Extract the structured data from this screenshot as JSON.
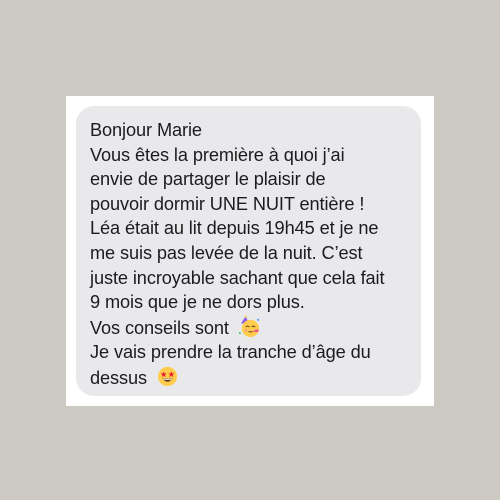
{
  "message": {
    "lines": [
      "Bonjour Marie",
      "Vous êtes la première à quoi j’ai",
      "envie de partager le plaisir de",
      "pouvoir dormir UNE NUIT entière !",
      "Léa était au lit depuis 19h45 et je ne",
      "me suis pas levée de la nuit. C’est",
      "juste incroyable sachant que cela fait",
      "9 mois que je ne dors plus.",
      "Vos conseils sont",
      "Je vais prendre la tranche d’âge du",
      "dessus"
    ],
    "emoji_1": "partying-face-icon",
    "emoji_2": "star-struck-icon"
  },
  "colors": {
    "background": "#ccc8c2",
    "card": "#ffffff",
    "bubble": "#e9e9eb",
    "text": "#1c1c1e"
  }
}
